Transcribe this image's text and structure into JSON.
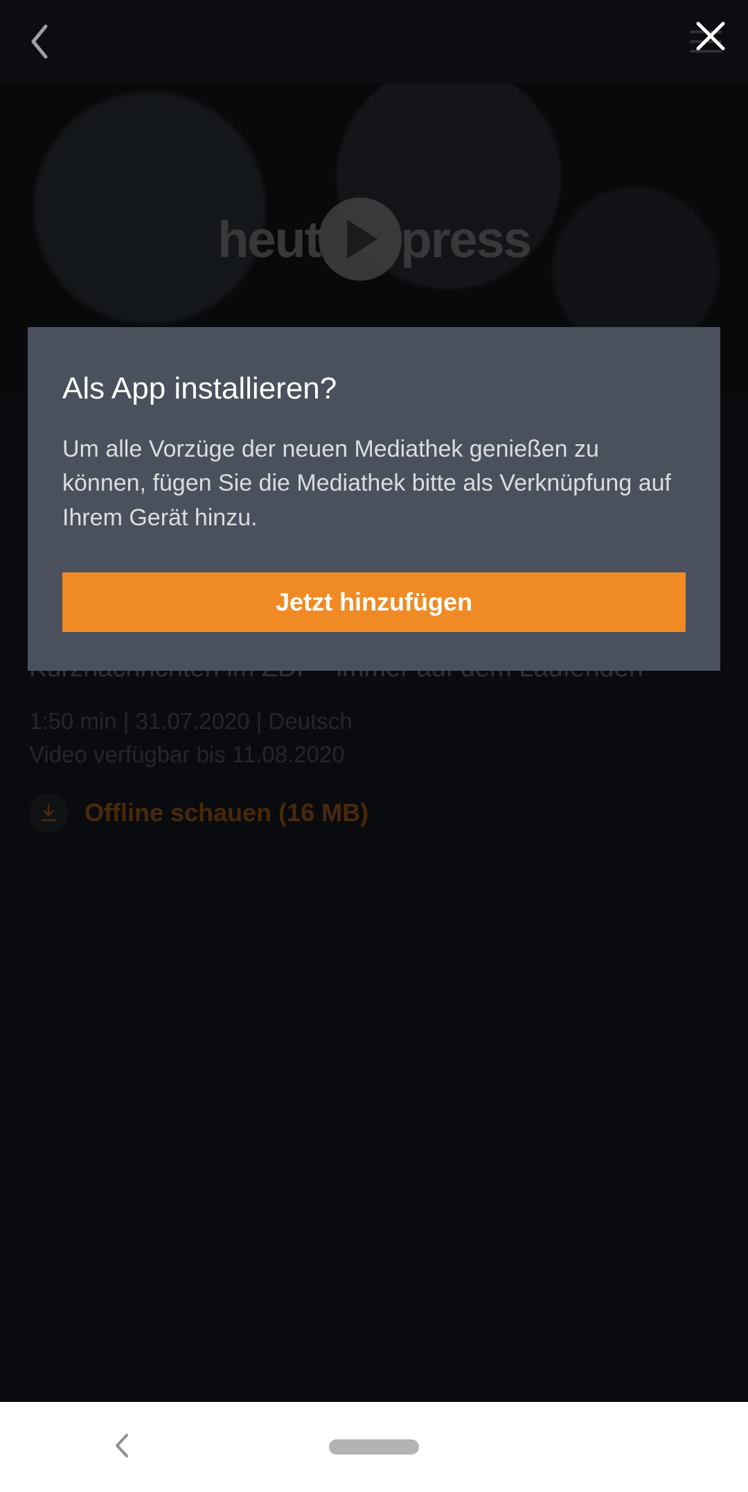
{
  "hero": {
    "logo_left": "heut",
    "logo_right": "press"
  },
  "content": {
    "subtitle": "Kurznachrichten im ZDF - immer auf dem Laufenden",
    "meta_line1": "1:50 min | 31.07.2020 | Deutsch",
    "meta_line2": "Video verfügbar bis 11.08.2020",
    "offline_label": "Offline schauen (16 MB)"
  },
  "modal": {
    "title": "Als App installieren?",
    "body": "Um alle Vorzüge der neuen Mediathek genießen zu können, fügen Sie die Mediathek bitte als Verknüpfung auf Ihrem Gerät hinzu.",
    "button": "Jetzt hinzufügen"
  },
  "colors": {
    "accent": "#f08a24",
    "modal_bg": "#4a515c"
  }
}
